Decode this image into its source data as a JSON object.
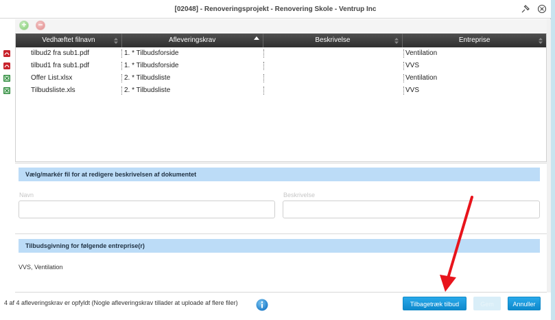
{
  "window": {
    "title": "[02048] - Renoveringsprojekt - Renovering Skole - Ventrup Inc"
  },
  "toolbar": {
    "add_symbol": "+",
    "remove_symbol": "−"
  },
  "grid": {
    "columns": [
      "Vedhæftet filnavn",
      "Afleveringskrav",
      "Beskrivelse",
      "Entreprise"
    ],
    "rows": [
      {
        "icon": "pdf-icon",
        "filename": "tilbud2 fra sub1.pdf",
        "requirement": "1. * Tilbudsforside",
        "description": "",
        "trade": "Ventilation"
      },
      {
        "icon": "pdf-icon",
        "filename": "tilbud1 fra sub1.pdf",
        "requirement": "1. * Tilbudsforside",
        "description": "",
        "trade": "VVS"
      },
      {
        "icon": "excel-icon",
        "filename": "Offer List.xlsx",
        "requirement": "2. * Tilbudsliste",
        "description": "",
        "trade": "Ventilation"
      },
      {
        "icon": "excel-icon",
        "filename": "Tilbudsliste.xls",
        "requirement": "2. * Tilbudsliste",
        "description": "",
        "trade": "VVS"
      }
    ]
  },
  "edit_panel": {
    "heading": "Vælg/markér fil for at redigere beskrivelsen af dokumentet",
    "name_label": "Navn",
    "name_value": "",
    "description_label": "Beskrivelse",
    "description_value": ""
  },
  "trades_panel": {
    "heading": "Tilbudsgivning for følgende entreprise(r)",
    "value": "VVS, Ventilation"
  },
  "footer": {
    "status": "4 af 4 afleveringskrav er opfyldt (Nogle afleveringskrav tillader at uploade af flere filer)",
    "withdraw_label": "Tilbagetræk tilbud",
    "save_label": "Gem",
    "cancel_label": "Annuller"
  },
  "colors": {
    "accent": "#1a9ad9",
    "section_bg": "#bcdcf7",
    "arrow": "#e8141c"
  }
}
